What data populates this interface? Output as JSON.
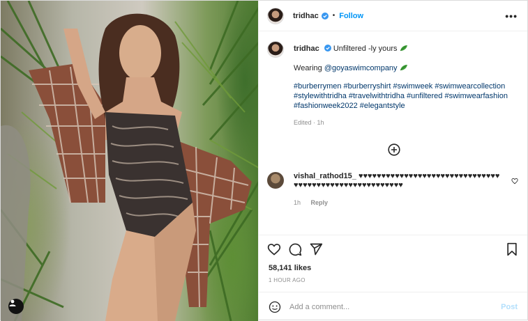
{
  "post": {
    "username": "tridhac",
    "follow_label": "Follow",
    "dot": "•",
    "more_label": "•••",
    "caption_title": "Unfiltered -ly yours",
    "caption_wearing": "Wearing",
    "caption_mention": "@goyaswimcompany",
    "hashtags": "#burberrymen #burberryshirt #swimweek #swimwearcollection #stylewithtridha #travelwithtridha #unfiltered #swimwearfashion #fashionweek2022 #elegantstyle",
    "edited": "Edited · 1h",
    "likes": "58,141 likes",
    "time_ago": "1 HOUR AGO"
  },
  "comment": {
    "username": "vishal_rathod15_",
    "text": "♥♥♥♥♥♥♥♥♥♥♥♥♥♥♥♥♥♥♥♥♥♥♥♥♥♥♥♥♥♥♥♥♥♥♥♥♥♥♥♥♥♥♥♥♥♥♥♥♥♥♥♥♥♥♥",
    "time": "1h",
    "reply_label": "Reply"
  },
  "composer": {
    "placeholder": "Add a comment...",
    "post_label": "Post"
  },
  "colors": {
    "link": "#0095f6",
    "hashtag": "#00376b",
    "muted": "#8e8e8e",
    "post_disabled": "#b2dffc"
  },
  "icons": [
    "verified-icon",
    "more-icon",
    "leaf-emoji-icon",
    "plus-circle-icon",
    "heart-icon",
    "comment-icon",
    "share-icon",
    "bookmark-icon",
    "emoji-icon",
    "user-tag-icon"
  ]
}
